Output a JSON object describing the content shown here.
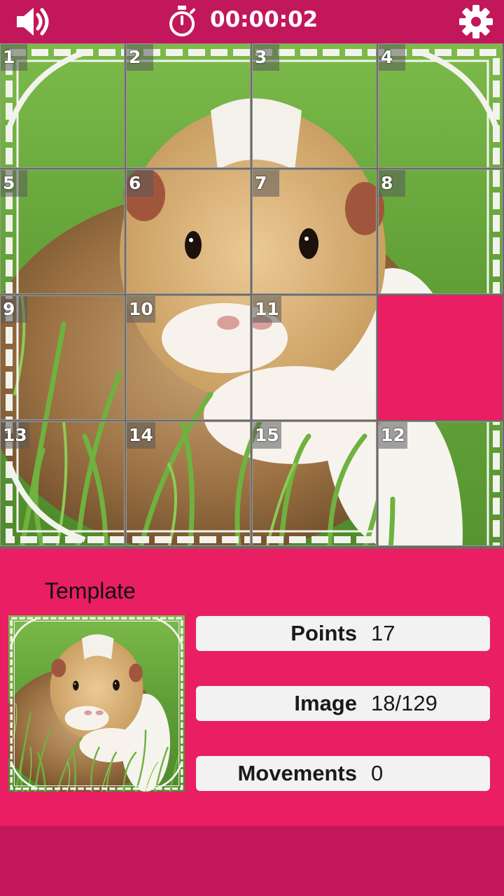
{
  "header": {
    "timer": "00:00:02",
    "sound_icon": "speaker-icon",
    "timer_icon": "stopwatch-icon",
    "settings_icon": "gear-icon"
  },
  "board": {
    "rows": 4,
    "cols": 4,
    "tiles": [
      {
        "label": "1",
        "piece": 1
      },
      {
        "label": "2",
        "piece": 2
      },
      {
        "label": "3",
        "piece": 3
      },
      {
        "label": "4",
        "piece": 4
      },
      {
        "label": "5",
        "piece": 5
      },
      {
        "label": "6",
        "piece": 6
      },
      {
        "label": "7",
        "piece": 7
      },
      {
        "label": "8",
        "piece": 8
      },
      {
        "label": "9",
        "piece": 9
      },
      {
        "label": "10",
        "piece": 10
      },
      {
        "label": "11",
        "piece": 11
      },
      {
        "label": "",
        "piece": 0
      },
      {
        "label": "13",
        "piece": 13
      },
      {
        "label": "14",
        "piece": 14
      },
      {
        "label": "15",
        "piece": 15
      },
      {
        "label": "12",
        "piece": 12
      }
    ]
  },
  "panel": {
    "template_label": "Template",
    "points_label": "Points",
    "points_value": "17",
    "image_label": "Image",
    "image_value": "18/129",
    "movements_label": "Movements",
    "movements_value": "0"
  },
  "colors": {
    "primary_dark": "#c2185b",
    "primary": "#e91e63",
    "stat_bg": "#f2f2f2"
  }
}
